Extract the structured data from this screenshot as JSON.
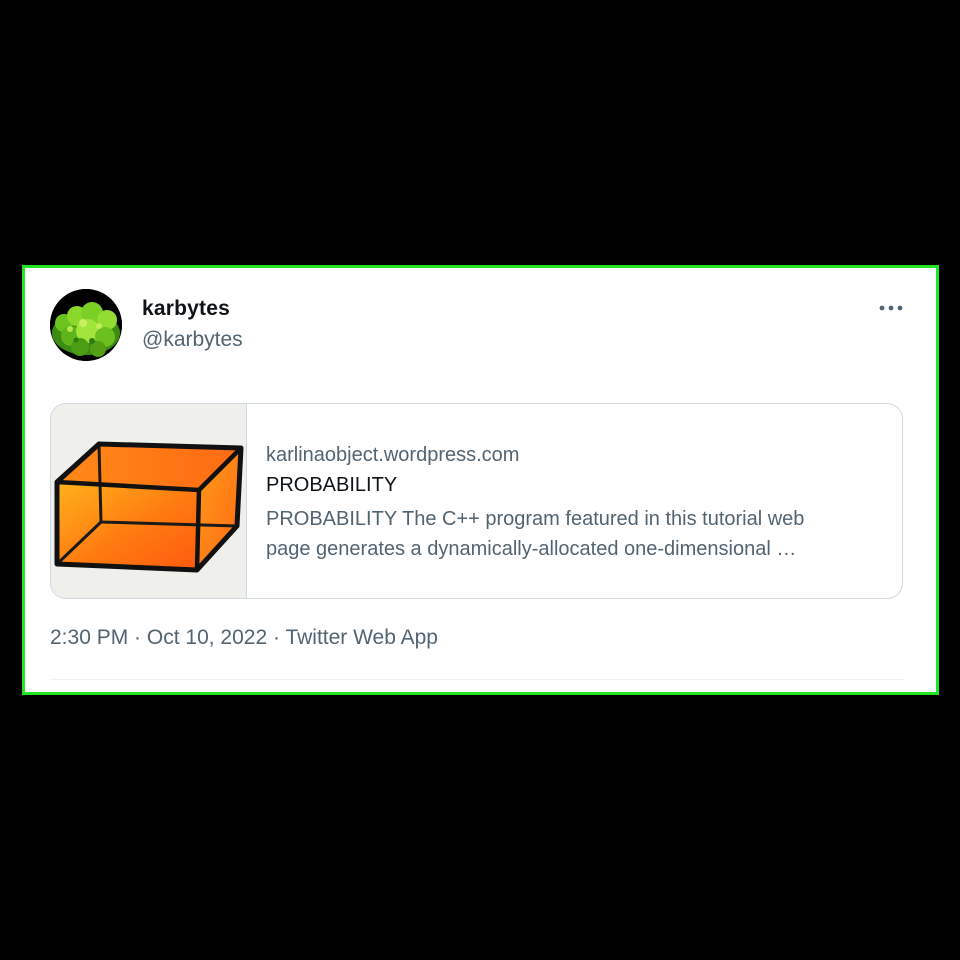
{
  "tweet": {
    "display_name": "karbytes",
    "handle": "@karbytes",
    "more_icon": "more-horizontal-icon",
    "card": {
      "domain": "karlinaobject.wordpress.com",
      "title": "PROBABILITY",
      "description_line1": "PROBABILITY The C++ program featured in this tutorial web",
      "description_line2": "page generates a dynamically-allocated one-dimensional …"
    },
    "time": "2:30 PM",
    "separator": " · ",
    "date": "Oct 10, 2022",
    "source": "Twitter Web App"
  },
  "colors": {
    "frame_border": "#22e61f",
    "text_primary": "#0f1419",
    "text_secondary": "#536471",
    "card_border": "#cfd9de",
    "box_orange": "#ff7a10",
    "box_yellow": "#ffc020"
  }
}
